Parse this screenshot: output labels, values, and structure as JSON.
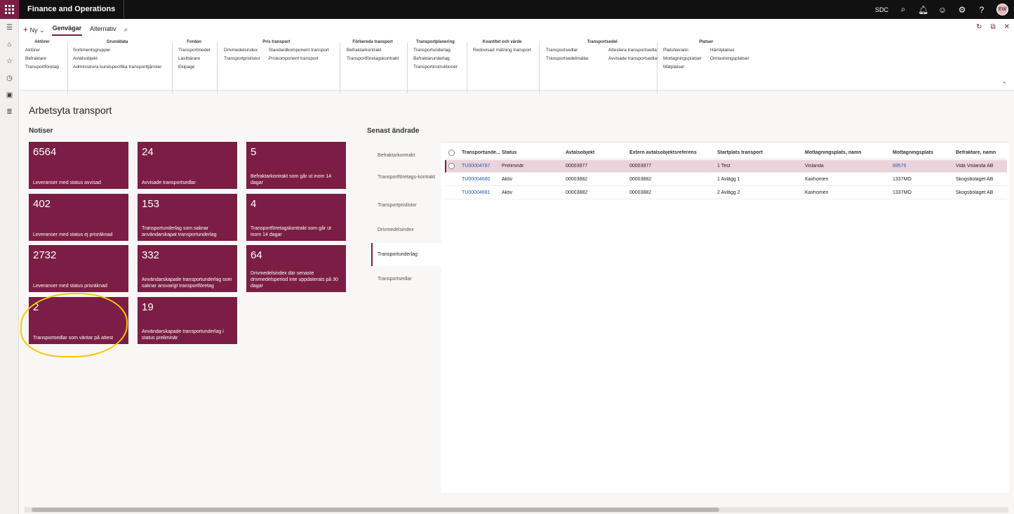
{
  "topbar": {
    "app_title": "Finance and Operations",
    "company": "SDC",
    "avatar": "EW",
    "icons": [
      "search-icon",
      "bell-icon",
      "smiley-icon",
      "gear-icon",
      "help-icon"
    ]
  },
  "leftnav": [
    "menu-icon",
    "home-icon",
    "star-icon",
    "clock-icon",
    "workspace-icon",
    "list-icon"
  ],
  "actionpane": {
    "new_label": "Ny",
    "tabs": [
      "Genvägar",
      "Alternativ"
    ],
    "groups": [
      {
        "title": "Aktörer",
        "cols": [
          [
            "Aktörer",
            "Befraktare",
            "Transportföretag"
          ]
        ]
      },
      {
        "title": "Grunddata",
        "cols": [
          [
            "Sortimentsgrupper",
            "Avtalsobjekt",
            "Administrera kundspecifika transporttjänster"
          ]
        ]
      },
      {
        "title": "Fordon",
        "cols": [
          [
            "Transportmedel",
            "Lastbärare",
            "Ekipage"
          ]
        ]
      },
      {
        "title": "Pris transport",
        "cols": [
          [
            "Drivmedelsindex",
            "Transportprislistor"
          ],
          [
            "Standardkomponent transport",
            "Priskomponent transport"
          ]
        ]
      },
      {
        "title": "Förbereda transport",
        "cols": [
          [
            "Befraktarkontrakt",
            "Transportföretagskontrakt"
          ]
        ]
      },
      {
        "title": "Transportplanering",
        "cols": [
          [
            "Transportunderlag",
            "Befraktarunderlag",
            "Transportinstruktioner"
          ]
        ]
      },
      {
        "title": "Kvantitet och värde",
        "cols": [
          [
            "Redovisad mätning transport"
          ]
        ]
      },
      {
        "title": "Transportsedel",
        "cols": [
          [
            "Transportsedlar",
            "Transportsedelmallar"
          ],
          [
            "Attestera transportsedlar",
            "Avvisade transportsedlar"
          ]
        ]
      },
      {
        "title": "Platser",
        "cols": [
          [
            "Platshierarki",
            "Mottagningsplatser",
            "Mätplatser"
          ],
          [
            "Hämtplatser",
            "Omlastningsplatser"
          ]
        ]
      }
    ]
  },
  "workspace": {
    "title": "Arbetsyta transport",
    "notices_title": "Notiser",
    "recent_title": "Senast ändrade",
    "tiles": [
      {
        "count": "6564",
        "label": "Leveranser med status avvisad"
      },
      {
        "count": "24",
        "label": "Avvisade transportsedlar"
      },
      {
        "count": "5",
        "label": "Befraktarkontrakt som går ut inom 14 dagar"
      },
      {
        "count": "402",
        "label": "Leveranser med status ej prisräknad"
      },
      {
        "count": "153",
        "label": "Transportunderlag som saknar användarskapat transportunderlag"
      },
      {
        "count": "4",
        "label": "Transportföretagskontrakt som går ut inom 14 dagar"
      },
      {
        "count": "2732",
        "label": "Leveranser med status prisräknad"
      },
      {
        "count": "332",
        "label": "Användarskapade transportunderlag som saknar ansvarigt transportföretag"
      },
      {
        "count": "64",
        "label": "Drivmedelsindex där senaste drivmedelsperiod inte uppdaterats på 30 dagar"
      },
      {
        "count": "2",
        "label": "Transportsedlar som väntar på attest"
      },
      {
        "count": "19",
        "label": "Användarskapade transportunderlag i status preliminär"
      }
    ],
    "recent_nav": [
      "Befraktarkontrakt",
      "Transportföretags-kontrakt",
      "Transportprislistor",
      "Drivmedelsindex",
      "Transportunderlag",
      "Transportsedlar"
    ],
    "recent_active": "Transportunderlag",
    "grid": {
      "headers": [
        "Transportunde...",
        "Status",
        "Avtalsobjekt",
        "Extern avtalsobjektsreferens",
        "Startplats transport",
        "Mottagningsplats, namn",
        "Mottagningsplats",
        "Befraktare, namn"
      ],
      "rows": [
        [
          "TU00004787",
          "Preliminär",
          "00003977",
          "00003977",
          "1 Test",
          "Vislanda",
          "89579",
          "Vida Vislanda AB"
        ],
        [
          "TU00004680",
          "Aktiv",
          "00003882",
          "00003882",
          "1 Avlägg 1",
          "Kaxhomen",
          "1337MO",
          "Skogsbolaget AB"
        ],
        [
          "TU00004681",
          "Aktiv",
          "00003882",
          "00003882",
          "2 Avlägg 2",
          "Kaxhomen",
          "1337MO",
          "Skogsbolaget AB"
        ]
      ]
    }
  }
}
